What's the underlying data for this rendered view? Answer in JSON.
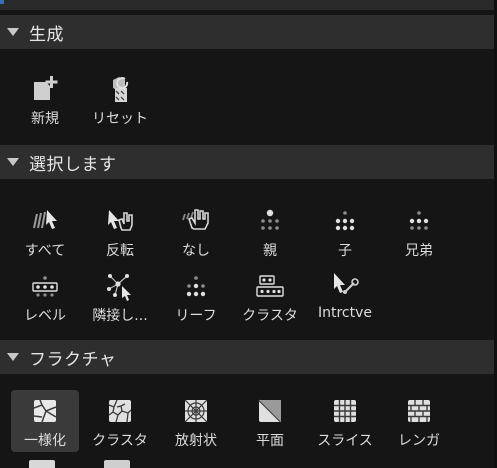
{
  "sections": [
    {
      "title": "生成",
      "tools": [
        {
          "label": "新規",
          "icon": "new-mesh-icon"
        },
        {
          "label": "リセット",
          "icon": "reset-icon"
        }
      ]
    },
    {
      "title": "選択します",
      "tools": [
        {
          "label": "すべて",
          "icon": "select-all-icon"
        },
        {
          "label": "反転",
          "icon": "invert-selection-icon"
        },
        {
          "label": "なし",
          "icon": "select-none-icon"
        },
        {
          "label": "親",
          "icon": "parent-icon"
        },
        {
          "label": "子",
          "icon": "child-icon"
        },
        {
          "label": "兄弟",
          "icon": "siblings-icon"
        },
        {
          "label": "レベル",
          "icon": "level-icon"
        },
        {
          "label": "隣接し...",
          "icon": "neighbors-icon"
        },
        {
          "label": "リーフ",
          "icon": "leaf-icon"
        },
        {
          "label": "クラスタ",
          "icon": "cluster-select-icon"
        },
        {
          "label": "Intrctve",
          "icon": "interactive-icon"
        }
      ]
    },
    {
      "title": "フラクチャ",
      "tools": [
        {
          "label": "一様化",
          "icon": "uniform-fracture-icon"
        },
        {
          "label": "クラスタ",
          "icon": "cluster-fracture-icon"
        },
        {
          "label": "放射状",
          "icon": "radial-fracture-icon"
        },
        {
          "label": "平面",
          "icon": "planar-fracture-icon"
        },
        {
          "label": "スライス",
          "icon": "slice-fracture-icon"
        },
        {
          "label": "レンガ",
          "icon": "brick-fracture-icon"
        }
      ]
    }
  ]
}
